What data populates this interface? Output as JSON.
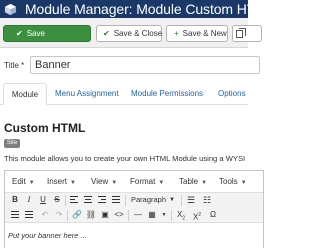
{
  "header": {
    "title": "Module Manager: Module Custom HTML",
    "logo_icon": "joomla-cube-icon",
    "bg_color": "#1a3867"
  },
  "toolbar": {
    "save_label": "Save",
    "save_close_label": "Save & Close",
    "save_new_label": "Save & New",
    "save_color": "#3c8f3f"
  },
  "title_field": {
    "label": "Title *",
    "value": "Banner"
  },
  "tabs": [
    {
      "label": "Module",
      "active": true
    },
    {
      "label": "Menu Assignment",
      "active": false
    },
    {
      "label": "Module Permissions",
      "active": false
    },
    {
      "label": "Options",
      "active": false
    }
  ],
  "section": {
    "title": "Custom HTML",
    "badge": "Site",
    "description": "This module allows you to create your own HTML Module using a WYSI"
  },
  "editor": {
    "menus": [
      "Edit",
      "Insert",
      "View",
      "Format",
      "Table",
      "Tools"
    ],
    "format_select": "Paragraph",
    "content": "Put your banner here ..."
  }
}
